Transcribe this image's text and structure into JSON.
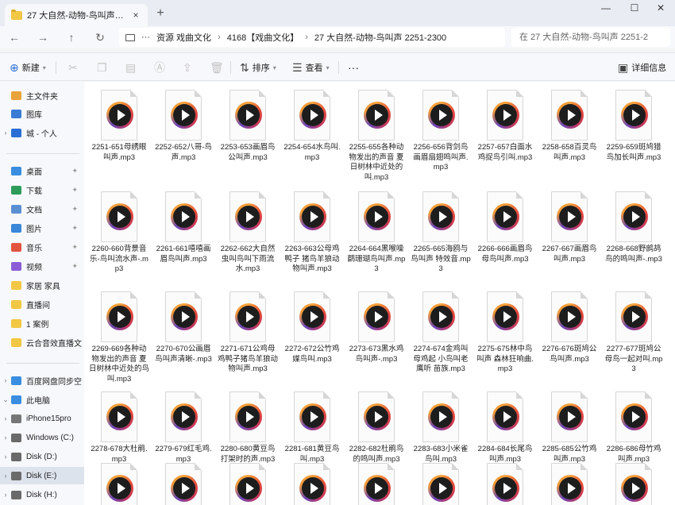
{
  "window": {
    "tab_title": "27 大自然-动物-鸟叫声 2251-2",
    "tab_close": "×",
    "new_tab": "+",
    "minimize": "—",
    "maximize": "☐",
    "close": "✕"
  },
  "nav": {
    "back": "←",
    "forward": "→",
    "up": "↑",
    "refresh": "↻",
    "more": "···",
    "breadcrumbs": [
      "资源 戏曲文化",
      "4168【戏曲文化】",
      "27 大自然-动物-鸟叫声 2251-2300"
    ],
    "separator": "›",
    "search_placeholder": "在 27 大自然-动物-鸟叫声 2251-2"
  },
  "toolbar": {
    "new_label": "新建",
    "sort_label": "排序",
    "view_label": "查看",
    "more_label": "···",
    "details_label": "详细信息"
  },
  "sidebar": {
    "items": [
      {
        "label": "主文件夹",
        "icon": "home-icon",
        "color": "#e8a33d"
      },
      {
        "label": "图库",
        "icon": "gallery-icon",
        "color": "#3a7bd5"
      },
      {
        "label": "城 - 个人",
        "icon": "cloud-icon",
        "color": "#2b6fd6"
      },
      {
        "label": "桌面",
        "icon": "desktop-icon",
        "color": "#3b8de0"
      },
      {
        "label": "下载",
        "icon": "download-icon",
        "color": "#2d9b5a"
      },
      {
        "label": "文档",
        "icon": "documents-icon",
        "color": "#5b8fd4"
      },
      {
        "label": "图片",
        "icon": "pictures-icon",
        "color": "#3a86d8"
      },
      {
        "label": "音乐",
        "icon": "music-icon",
        "color": "#e2543f"
      },
      {
        "label": "视频",
        "icon": "video-icon",
        "color": "#8b5cd6"
      },
      {
        "label": "家居 家具",
        "icon": "folder-icon",
        "color": "#f2c744"
      },
      {
        "label": "直播间",
        "icon": "folder-icon",
        "color": "#f2c744"
      },
      {
        "label": "1 案例",
        "icon": "folder-icon",
        "color": "#f2c744"
      },
      {
        "label": "云合音效直播文",
        "icon": "folder-icon",
        "color": "#f2c744"
      },
      {
        "label": "百度网盘同步空",
        "icon": "cloud-drive-icon",
        "color": "#3b8de0"
      },
      {
        "label": "此电脑",
        "icon": "computer-icon",
        "color": "#3b8de0"
      },
      {
        "label": "iPhone15pro",
        "icon": "phone-icon",
        "color": "#777777"
      },
      {
        "label": "Windows (C:)",
        "icon": "drive-icon",
        "color": "#6a6a6a"
      },
      {
        "label": "Disk (D:)",
        "icon": "drive-icon",
        "color": "#6a6a6a"
      },
      {
        "label": "Disk (E:)",
        "icon": "drive-icon",
        "color": "#6a6a6a"
      },
      {
        "label": "Disk (H:)",
        "icon": "drive-icon",
        "color": "#6a6a6a"
      }
    ]
  },
  "files": [
    "2251-651母绣眼叫声.mp3",
    "2252-652八哥-鸟声.mp3",
    "2253-653画眉鸟公叫声.mp3",
    "2254-654水鸟叫.mp3",
    "2255-655各种动物发出的声音 夏日树林中近处的叫.mp3",
    "2256-656背剑鸟画眉扇翅鸣叫声.mp3",
    "2257-657白面水鸡捉鸟引叫.mp3",
    "2258-658百灵鸟叫声.mp3",
    "2259-659斑鸠猎鸟加长叫声.mp3",
    "2260-660背景音乐-鸟叫流水声-.mp3",
    "2261-661嘻嘻画眉鸟叫声.mp3",
    "2262-662大自然虫叫鸟叫下雨流水.mp3",
    "2263-663公母鸡鸭子 猪鸟羊狼动物叫声.mp3",
    "2264-664黑喉噪鹛珊瑚鸟叫声.mp3",
    "2265-665海鸥与鸟叫声 特效音.mp3",
    "2266-666画眉鸟母鸟叫声.mp3",
    "2267-667画眉鸟叫声.mp3",
    "2268-668野鹧鸪鸟的鸣叫声-.mp3",
    "2269-669各种动物发出的声音 夏日树林中近处的鸟叫.mp3",
    "2270-670公画眉鸟叫声清晰-.mp3",
    "2271-671公鸡母鸡鸭子猪鸟羊狼动物叫声.mp3",
    "2272-672公竹鸡媒鸟叫.mp3",
    "2273-673黑水鸡鸟叫声-.mp3",
    "2274-674金鸡叫母鸡起 小鸟叫老鹰听 苗族.mp3",
    "2275-675林中鸟叫声 森林狂响曲.mp3",
    "2276-676斑鸠公鸟叫声.mp3",
    "2277-677斑鸠公母鸟一起对叫.mp3",
    "2278-678大杜鹃.mp3",
    "2279-679红毛鸡.mp3",
    "2280-680黄豆鸟打架时的声.mp3",
    "2281-681黄豆鸟叫.mp3",
    "2282-682杜鹃鸟的鸣叫声.mp3",
    "2283-683小米雀鸟叫.mp3",
    "2284-684长尾鸟叫声.mp3",
    "2285-685公竹鸡叫声.mp3",
    "2286-686母竹鸡叫声.mp3",
    "",
    "",
    "",
    "",
    "",
    "",
    "",
    "",
    ""
  ]
}
